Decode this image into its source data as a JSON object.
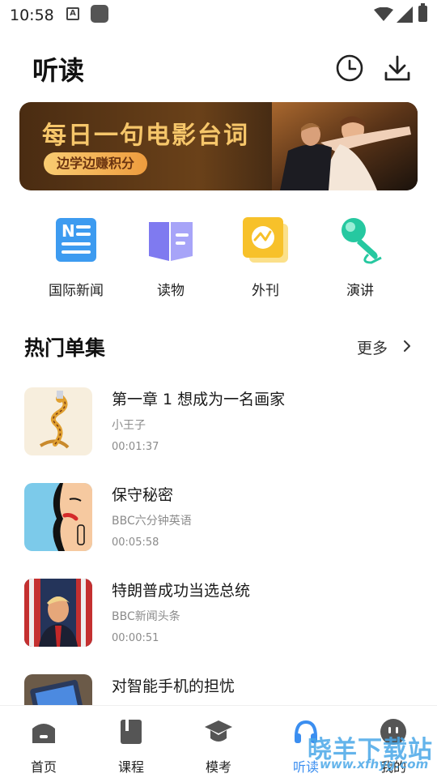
{
  "status_bar": {
    "time": "10:58",
    "a_icon": "A"
  },
  "header": {
    "title": "听读",
    "icons": [
      "history-icon",
      "download-icon"
    ]
  },
  "banner": {
    "title": "每日一句电影台词",
    "badge": "边学边赚积分"
  },
  "categories": [
    {
      "label": "国际新闻",
      "icon": "news-icon",
      "color": "#3d9bf0"
    },
    {
      "label": "读物",
      "icon": "book-icon",
      "color": "#8b86f4"
    },
    {
      "label": "外刊",
      "icon": "magazine-icon",
      "color": "#f7c12a"
    },
    {
      "label": "演讲",
      "icon": "microphone-icon",
      "color": "#26c8a0"
    }
  ],
  "hot": {
    "title": "热门单集",
    "more": "更多",
    "items": [
      {
        "title": "第一章 1 想成为一名画家",
        "sub": "小王子",
        "duration": "00:01:37"
      },
      {
        "title": "保守秘密",
        "sub": "BBC六分钟英语",
        "duration": "00:05:58"
      },
      {
        "title": "特朗普成功当选总统",
        "sub": "BBC新闻头条",
        "duration": "00:00:51"
      },
      {
        "title": "对智能手机的担忧",
        "sub": "",
        "duration": ""
      }
    ]
  },
  "nav": [
    {
      "label": "首页",
      "icon": "home-icon"
    },
    {
      "label": "课程",
      "icon": "course-icon"
    },
    {
      "label": "模考",
      "icon": "exam-icon"
    },
    {
      "label": "听读",
      "icon": "listen-icon",
      "active": true
    },
    {
      "label": "我的",
      "icon": "profile-icon"
    }
  ],
  "watermark": {
    "text": "晓羊下载站",
    "url": "www.xfhyg.com"
  },
  "colors": {
    "accent": "#3b8ef0",
    "banner_gold": "#f6c66a"
  }
}
